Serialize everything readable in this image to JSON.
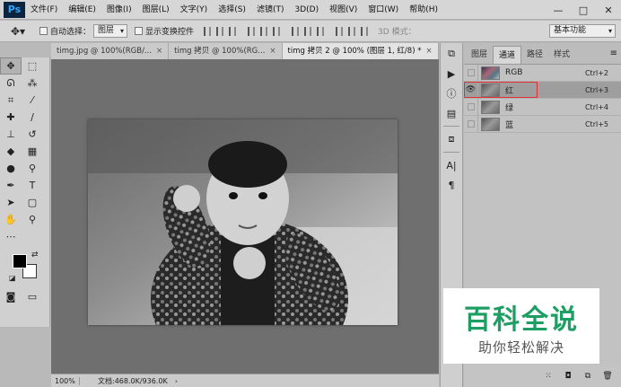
{
  "app": {
    "logo": "Ps",
    "menus": [
      "文件(F)",
      "编辑(E)",
      "图像(I)",
      "图层(L)",
      "文字(Y)",
      "选择(S)",
      "滤镜(T)",
      "3D(D)",
      "视图(V)",
      "窗口(W)",
      "帮助(H)"
    ],
    "window_controls": {
      "minimize": "—",
      "maximize": "□",
      "close": "✕"
    }
  },
  "options": {
    "auto_select_label": "自动选择：",
    "auto_select_value": "图层",
    "show_transform_label": "显示变换控件",
    "mode3d_label": "3D 模式：",
    "workspace_value": "基本功能"
  },
  "tabs": [
    {
      "label": "timg.jpg @ 100%(RGB/...",
      "close": "×",
      "active": false
    },
    {
      "label": "timg 拷贝 @ 100%(RG...",
      "close": "×",
      "active": false
    },
    {
      "label": "timg 拷贝 2 @ 100% (图层 1, 红/8) *",
      "close": "×",
      "active": true
    }
  ],
  "status": {
    "zoom": "100%",
    "doc_size": "文档:468.0K/936.0K",
    "arrow": "›"
  },
  "panel": {
    "tabs": [
      "图层",
      "通道",
      "路径",
      "样式"
    ],
    "active_tab": "通道",
    "menu_icon": "≡",
    "channels": [
      {
        "name": "RGB",
        "shortcut": "Ctrl+2",
        "visible": false,
        "selected": false
      },
      {
        "name": "红",
        "shortcut": "Ctrl+3",
        "visible": true,
        "selected": true
      },
      {
        "name": "绿",
        "shortcut": "Ctrl+4",
        "visible": false,
        "selected": false
      },
      {
        "name": "蓝",
        "shortcut": "Ctrl+5",
        "visible": false,
        "selected": false
      }
    ]
  },
  "watermark": {
    "title": "百科全说",
    "subtitle": "助你轻松解决",
    "color": "#1d9e63"
  },
  "colors": {
    "foreground": "#000000",
    "background": "#ffffff",
    "highlight": "#e03030"
  }
}
